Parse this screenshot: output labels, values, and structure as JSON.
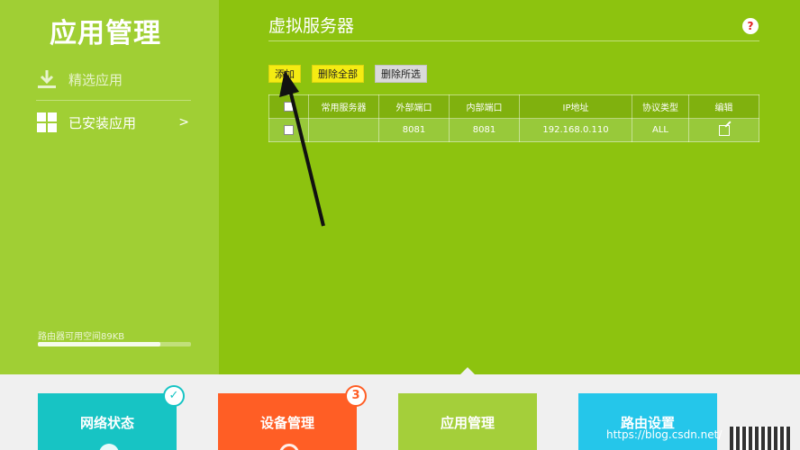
{
  "sidebar": {
    "app_title": "应用管理",
    "items": [
      {
        "label": "精选应用",
        "icon": "download-icon"
      },
      {
        "label": "已安装应用",
        "icon": "grid-icon",
        "chevron": ">"
      }
    ],
    "storage_text": "路由器可用空间89KB",
    "storage_used": 0.8
  },
  "main": {
    "title": "虚拟服务器",
    "help_label": "?",
    "toolbar": {
      "add": "添加",
      "delete_all": "删除全部",
      "delete_selected": "删除所选"
    },
    "table": {
      "headers": [
        "",
        "常用服务器",
        "外部端口",
        "内部端口",
        "IP地址",
        "协议类型",
        "编辑"
      ],
      "rows": [
        {
          "service": "",
          "external_port": "8081",
          "internal_port": "8081",
          "ip": "192.168.0.110",
          "protocol": "ALL"
        }
      ]
    }
  },
  "bottom_nav": {
    "tiles": [
      {
        "label": "网络状态",
        "color": "#17c4c4",
        "badge": "✓"
      },
      {
        "label": "设备管理",
        "color": "#ff5e25",
        "badge": "3"
      },
      {
        "label": "应用管理",
        "color": "#a4cf3a"
      },
      {
        "label": "路由设置",
        "color": "#25c6ea"
      }
    ]
  },
  "watermark": "https://blog.csdn.net/"
}
